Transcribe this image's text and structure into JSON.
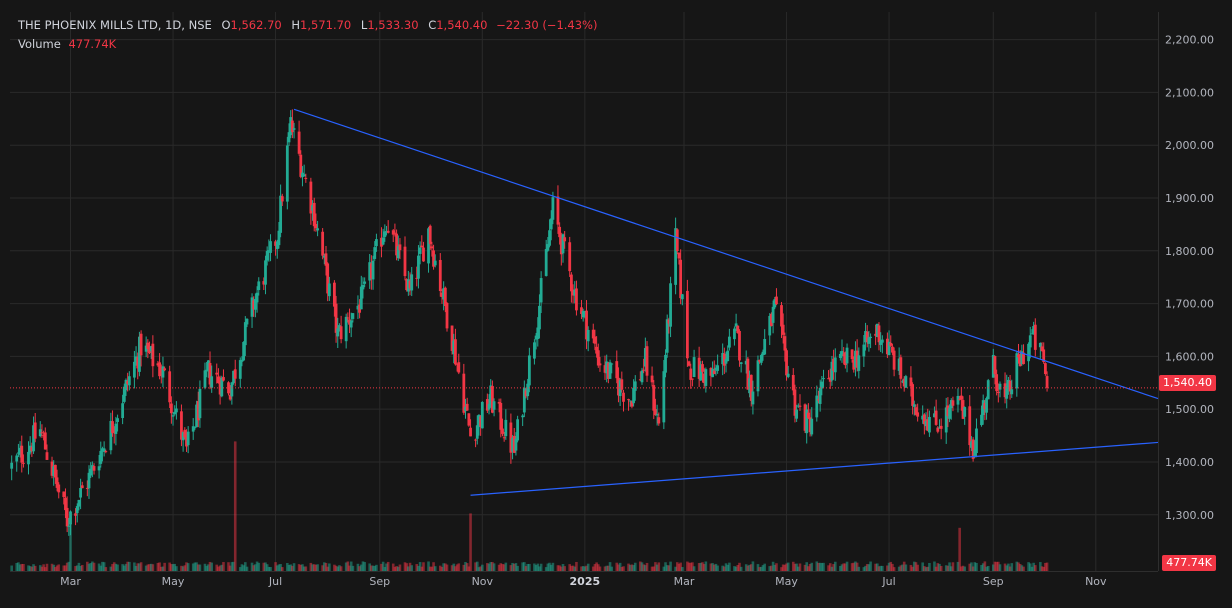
{
  "header": {
    "symbol": "THE PHOENIX MILLS LTD, 1D, NSE",
    "o_label": "O",
    "o_value": "1,562.70",
    "h_label": "H",
    "h_value": "1,571.70",
    "l_label": "L",
    "l_value": "1,533.30",
    "c_label": "C",
    "c_value": "1,540.40",
    "change": "−22.30 (−1.43%)",
    "volume_label": "Volume",
    "volume_value": "477.74K"
  },
  "price_tag": "1,540.40",
  "volume_tag": "477.74K",
  "colors": {
    "up": "#22ab94",
    "down": "#f23645",
    "trendline": "#2962ff",
    "grid": "#2a2a2a",
    "background": "#161616"
  },
  "chart_data": {
    "type": "candlestick",
    "y_axis_ticks": [
      "2,200.00",
      "2,100.00",
      "2,000.00",
      "1,900.00",
      "1,800.00",
      "1,700.00",
      "1,600.00",
      "1,500.00",
      "1,400.00",
      "1,300.00"
    ],
    "y_tick_values": [
      2200,
      2100,
      2000,
      1900,
      1800,
      1700,
      1600,
      1500,
      1400,
      1300
    ],
    "x_axis_ticks": [
      "Mar",
      "May",
      "Jul",
      "Sep",
      "Nov",
      "2025",
      "Mar",
      "May",
      "Jul",
      "Sep",
      "Nov"
    ],
    "x_tick_dates": [
      "2024-03-01",
      "2024-05-01",
      "2024-07-01",
      "2024-09-01",
      "2024-11-01",
      "2025-01-01",
      "2025-03-01",
      "2025-05-01",
      "2025-07-01",
      "2025-09-01",
      "2025-11-01"
    ],
    "x_range": [
      "2024-01-25",
      "2025-12-08"
    ],
    "y_range": [
      1220,
      2222
    ],
    "last_close": 1540.4,
    "trendlines": [
      {
        "from": [
          "2024-07-12",
          2068
        ],
        "to": [
          "2025-12-08",
          1520
        ]
      },
      {
        "from": [
          "2024-10-25",
          1337
        ],
        "to": [
          "2025-12-08",
          1437
        ]
      }
    ],
    "anchors": [
      [
        "2024-01-26",
        1390
      ],
      [
        "2024-02-12",
        1460
      ],
      [
        "2024-02-28",
        1290
      ],
      [
        "2024-03-12",
        1370
      ],
      [
        "2024-03-26",
        1470
      ],
      [
        "2024-04-12",
        1620
      ],
      [
        "2024-04-25",
        1570
      ],
      [
        "2024-05-09",
        1420
      ],
      [
        "2024-05-22",
        1570
      ],
      [
        "2024-06-04",
        1540
      ],
      [
        "2024-06-18",
        1700
      ],
      [
        "2024-07-02",
        1830
      ],
      [
        "2024-07-10",
        2040
      ],
      [
        "2024-07-24",
        1870
      ],
      [
        "2024-08-07",
        1640
      ],
      [
        "2024-08-22",
        1710
      ],
      [
        "2024-09-05",
        1860
      ],
      [
        "2024-09-19",
        1720
      ],
      [
        "2024-09-30",
        1840
      ],
      [
        "2024-10-15",
        1620
      ],
      [
        "2024-10-25",
        1450
      ],
      [
        "2024-11-06",
        1520
      ],
      [
        "2024-11-20",
        1420
      ],
      [
        "2024-12-05",
        1700
      ],
      [
        "2024-12-13",
        1880
      ],
      [
        "2024-12-26",
        1720
      ],
      [
        "2025-01-10",
        1590
      ],
      [
        "2025-01-28",
        1520
      ],
      [
        "2025-02-06",
        1590
      ],
      [
        "2025-02-14",
        1470
      ],
      [
        "2025-02-24",
        1820
      ],
      [
        "2025-03-04",
        1580
      ],
      [
        "2025-03-18",
        1560
      ],
      [
        "2025-04-01",
        1640
      ],
      [
        "2025-04-10",
        1540
      ],
      [
        "2025-04-24",
        1690
      ],
      [
        "2025-05-06",
        1510
      ],
      [
        "2025-05-14",
        1470
      ],
      [
        "2025-05-28",
        1580
      ],
      [
        "2025-06-12",
        1600
      ],
      [
        "2025-06-24",
        1650
      ],
      [
        "2025-07-03",
        1600
      ],
      [
        "2025-07-14",
        1520
      ],
      [
        "2025-07-28",
        1470
      ],
      [
        "2025-08-12",
        1510
      ],
      [
        "2025-08-20",
        1430
      ],
      [
        "2025-09-01",
        1580
      ],
      [
        "2025-09-08",
        1510
      ],
      [
        "2025-09-15",
        1580
      ],
      [
        "2025-09-24",
        1640
      ],
      [
        "2025-10-01",
        1590
      ],
      [
        "2025-10-03",
        1540
      ]
    ],
    "volume_spikes": [
      [
        "2024-03-01",
        1.0
      ],
      [
        "2024-06-07",
        2.7
      ],
      [
        "2024-10-25",
        1.2
      ],
      [
        "2025-08-12",
        0.9
      ]
    ]
  }
}
